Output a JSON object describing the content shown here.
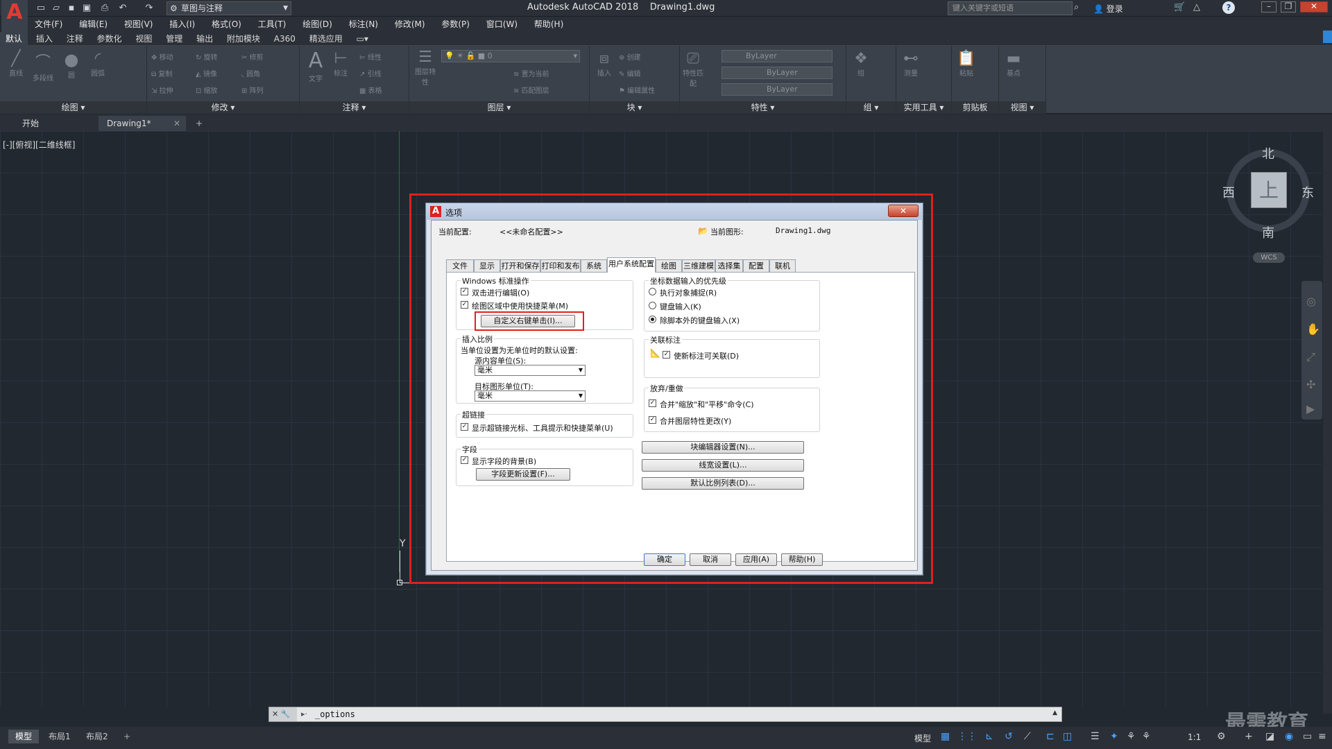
{
  "app": {
    "title": "Autodesk AutoCAD 2018",
    "document": "Drawing1.dwg",
    "workspace": "草图与注释",
    "search_placeholder": "键入关键字或短语",
    "login": "登录"
  },
  "menubar": [
    "文件(F)",
    "编辑(E)",
    "视图(V)",
    "插入(I)",
    "格式(O)",
    "工具(T)",
    "绘图(D)",
    "标注(N)",
    "修改(M)",
    "参数(P)",
    "窗口(W)",
    "帮助(H)"
  ],
  "ribbon_tabs": [
    "默认",
    "插入",
    "注释",
    "参数化",
    "视图",
    "管理",
    "输出",
    "附加模块",
    "A360",
    "精选应用"
  ],
  "ribbon": {
    "panels": {
      "draw": "绘图",
      "modify": "修改",
      "annotation": "注释",
      "layers": "图层",
      "block": "块",
      "properties": "特性",
      "groups": "组",
      "utilities": "实用工具",
      "clipboard": "剪贴板",
      "view": "视图"
    },
    "draw_tools": [
      "直线",
      "多段线",
      "圆",
      "圆弧"
    ],
    "modify_tools": [
      "移动",
      "旋转",
      "修剪",
      "复制",
      "镜像",
      "圆角",
      "拉伸",
      "缩放",
      "阵列"
    ],
    "annot_tools": [
      "文字",
      "标注",
      "线性",
      "引线",
      "表格"
    ],
    "layer_tools": [
      "图层特性",
      "置为当前",
      "匹配图层"
    ],
    "layer_value": "0",
    "block_tools": [
      "插入",
      "创建",
      "编辑",
      "编辑属性"
    ],
    "props": [
      "ByLayer",
      "ByLayer",
      "ByLayer"
    ],
    "props_tools": [
      "特性匹配"
    ],
    "group_tool": "组",
    "util_tool": "测量",
    "clip_tool": "粘贴",
    "view_tool": "基点"
  },
  "file_tabs": [
    "开始",
    "Drawing1*"
  ],
  "viewport_label": "[-][俯视][二维线框]",
  "viewcube": {
    "north": "北",
    "south": "南",
    "east": "东",
    "west": "西",
    "face": "上",
    "wcs": "WCS"
  },
  "ucs_y": "Y",
  "dialog": {
    "title": "选项",
    "current_profile_label": "当前配置:",
    "current_profile": "<<未命名配置>>",
    "current_drawing_label": "当前图形:",
    "current_drawing": "Drawing1.dwg",
    "tabs": [
      "文件",
      "显示",
      "打开和保存",
      "打印和发布",
      "系统",
      "用户系统配置",
      "绘图",
      "三维建模",
      "选择集",
      "配置",
      "联机"
    ],
    "active_tab": "用户系统配置",
    "windows_group": {
      "title": "Windows 标准操作",
      "dbl_click": "双击进行编辑(O)",
      "shortcut_menu": "绘图区域中使用快捷菜单(M)",
      "custom_right_click": "自定义右键单击(I)..."
    },
    "insert_scale": {
      "title": "插入比例",
      "desc": "当单位设置为无单位时的默认设置:",
      "source_label": "源内容单位(S):",
      "source_value": "毫米",
      "target_label": "目标图形单位(T):",
      "target_value": "毫米"
    },
    "hyperlink": {
      "title": "超链接",
      "show": "显示超链接光标、工具提示和快捷菜单(U)"
    },
    "fields": {
      "title": "字段",
      "show_bg": "显示字段的背景(B)",
      "update_btn": "字段更新设置(F)..."
    },
    "coord_priority": {
      "title": "坐标数据输入的优先级",
      "opt1": "执行对象捕捉(R)",
      "opt2": "键盘输入(K)",
      "opt3": "除脚本外的键盘输入(X)"
    },
    "assoc_dim": {
      "title": "关联标注",
      "make_new": "使新标注可关联(D)"
    },
    "undo_redo": {
      "title": "放弃/重做",
      "combine_zoom": "合并\"缩放\"和\"平移\"命令(C)",
      "combine_layer": "合并图层特性更改(Y)"
    },
    "block_editor_btn": "块编辑器设置(N)...",
    "lineweight_btn": "线宽设置(L)...",
    "scale_list_btn": "默认比例列表(D)...",
    "ok": "确定",
    "cancel": "取消",
    "apply": "应用(A)",
    "help": "帮助(H)"
  },
  "command_line": "_options",
  "layout_tabs": [
    "模型",
    "布局1",
    "布局2"
  ],
  "status": {
    "model": "模型",
    "scale": "1:1"
  },
  "watermark": "最需教育"
}
